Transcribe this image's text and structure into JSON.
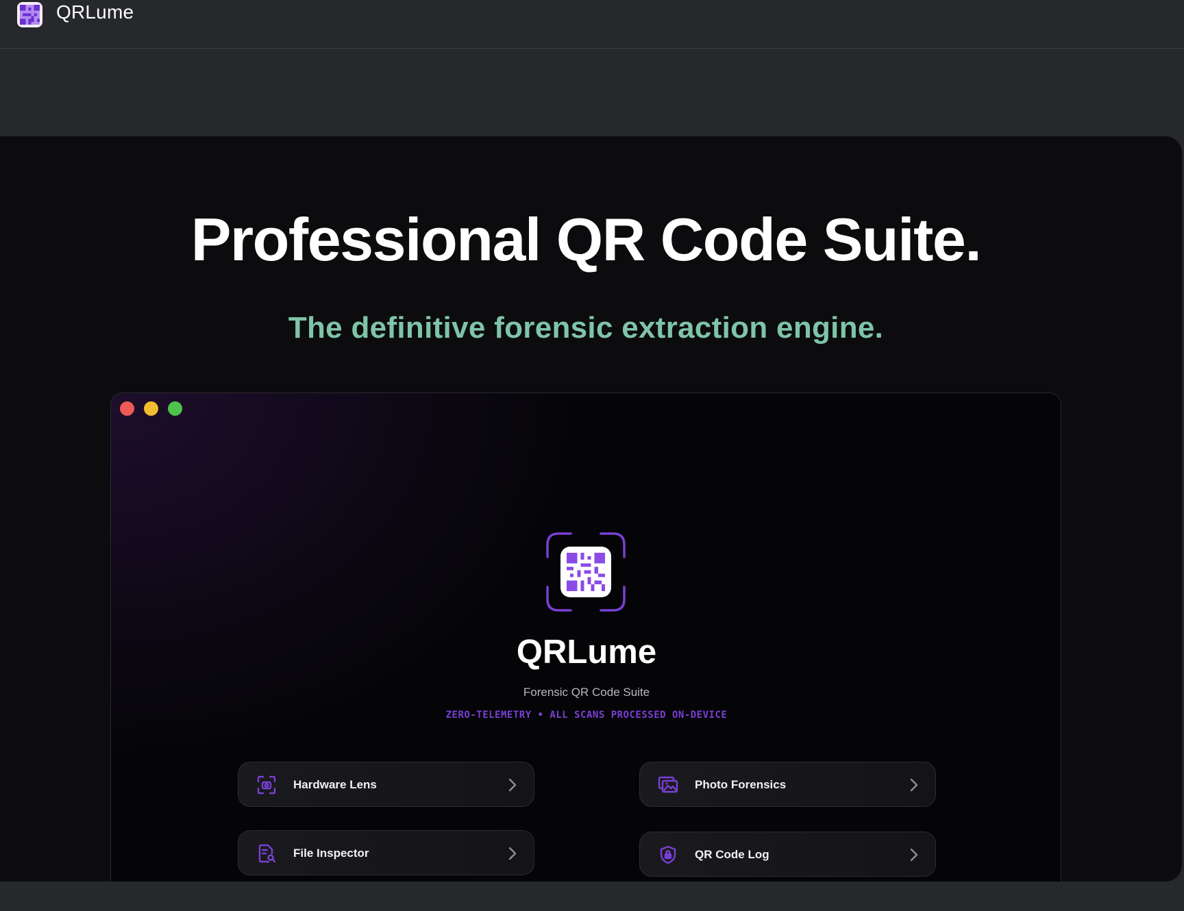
{
  "header": {
    "app_name": "QRLume"
  },
  "hero": {
    "title": "Professional QR Code Suite.",
    "subtitle": "The definitive forensic extraction engine.",
    "subtitle_color": "#7fc4a8"
  },
  "preview_window": {
    "app_name": "QRLume",
    "tagline": "Forensic QR Code Suite",
    "privacy_note": "ZERO-TELEMETRY • ALL SCANS PROCESSED ON-DEVICE",
    "accent_color": "#7a3fd6",
    "features": [
      {
        "label": "Hardware Lens",
        "icon": "camera-scan-icon"
      },
      {
        "label": "Photo Forensics",
        "icon": "photos-icon"
      },
      {
        "label": "File Inspector",
        "icon": "document-search-icon"
      },
      {
        "label": "QR Code Log",
        "icon": "shield-lock-icon"
      }
    ]
  }
}
